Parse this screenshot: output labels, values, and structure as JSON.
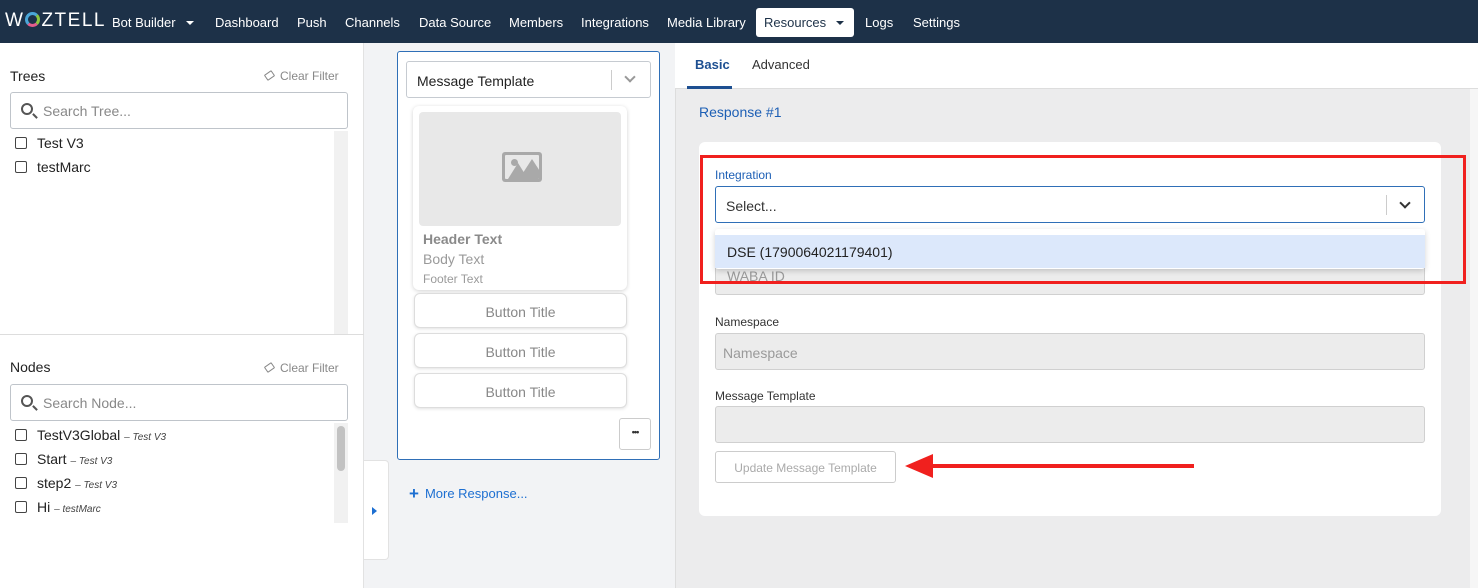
{
  "brand": {
    "logo_text": "WOZTELL"
  },
  "nav": {
    "bot_builder": "Bot Builder",
    "items": [
      "Dashboard",
      "Push",
      "Channels",
      "Data Source",
      "Members",
      "Integrations",
      "Media Library"
    ],
    "active": "Resources",
    "after": [
      "Logs",
      "Settings"
    ]
  },
  "trees": {
    "title": "Trees",
    "clear_filter": "Clear Filter",
    "search_placeholder": "Search Tree...",
    "items": [
      "Test V3",
      "testMarc"
    ]
  },
  "nodes": {
    "title": "Nodes",
    "clear_filter": "Clear Filter",
    "search_placeholder": "Search Node...",
    "items": [
      {
        "name": "TestV3Global",
        "tree": "Test V3"
      },
      {
        "name": "Start",
        "tree": "Test V3"
      },
      {
        "name": "step2",
        "tree": "Test V3"
      },
      {
        "name": "Hi",
        "tree": "testMarc"
      }
    ],
    "separator": "–"
  },
  "response_card": {
    "type_value": "Message Template",
    "header_text": "Header Text",
    "body_text": "Body Text",
    "footer_text": "Footer Text",
    "buttons": [
      "Button Title",
      "Button Title",
      "Button Title"
    ],
    "more_icon": "•••",
    "more_response": "More Response..."
  },
  "editor": {
    "tabs": [
      "Basic",
      "Advanced"
    ],
    "active_tab": "Basic",
    "response_label": "Response #1",
    "integration_label": "Integration",
    "integration_placeholder": "Select...",
    "integration_option": "DSE (1790064021179401)",
    "waba_placeholder": "WABA ID",
    "namespace_label": "Namespace",
    "namespace_placeholder": "Namespace",
    "message_template_label": "Message Template",
    "update_button": "Update Message Template"
  },
  "colors": {
    "nav_bg": "#1d3148",
    "accent": "#1d5fb5",
    "highlight": "#f0201e",
    "option_bg": "#dce8fb"
  }
}
